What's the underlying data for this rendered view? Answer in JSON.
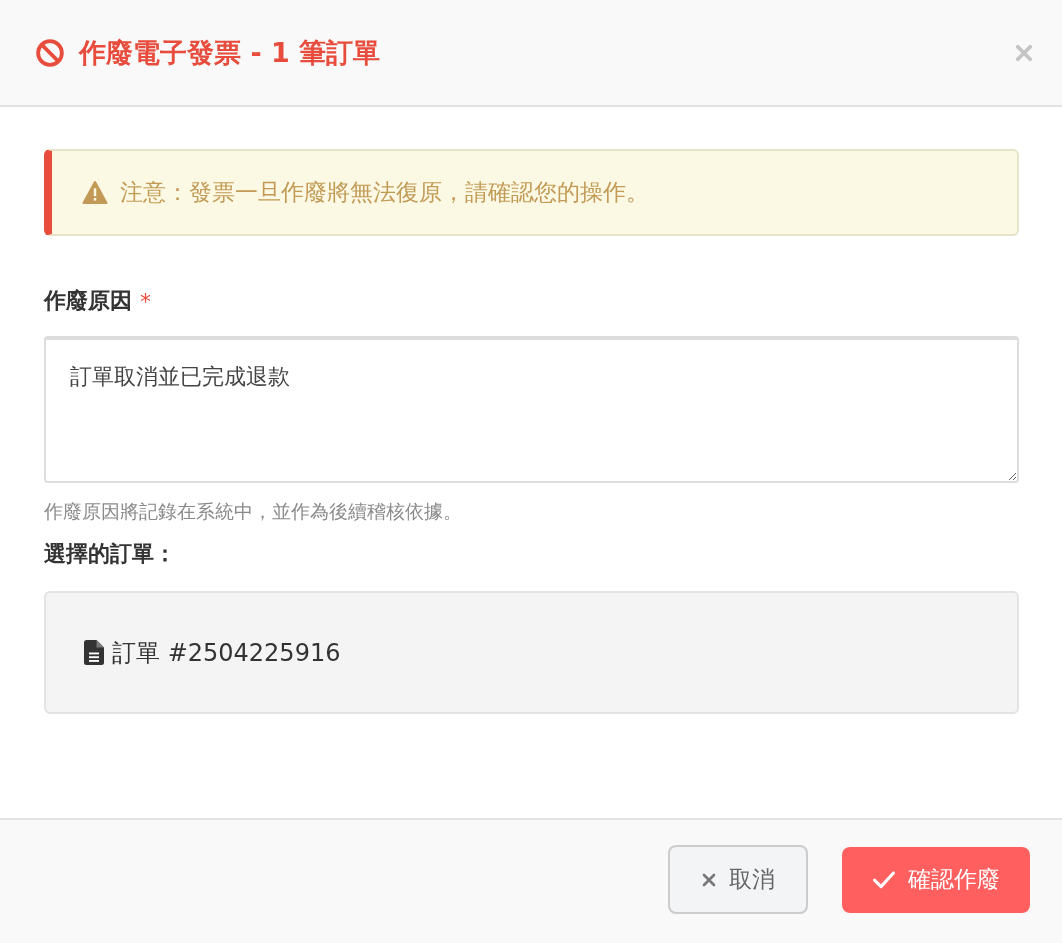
{
  "dialog": {
    "title": "作廢電子發票 - 1 筆訂單"
  },
  "alert": {
    "text": "注意：發票一旦作廢將無法復原，請確認您的操作。"
  },
  "reason_field": {
    "label": "作廢原因",
    "required_mark": "*",
    "value": "訂單取消並已完成退款",
    "help": "作廢原因將記錄在系統中，並作為後續稽核依據。"
  },
  "orders_section": {
    "label": "選擇的訂單：",
    "orders": [
      "訂單 #2504225916"
    ]
  },
  "buttons": [
    {
      "kind": "cancel",
      "label": "取消"
    },
    {
      "kind": "confirm",
      "label": "確認作廢"
    }
  ]
}
